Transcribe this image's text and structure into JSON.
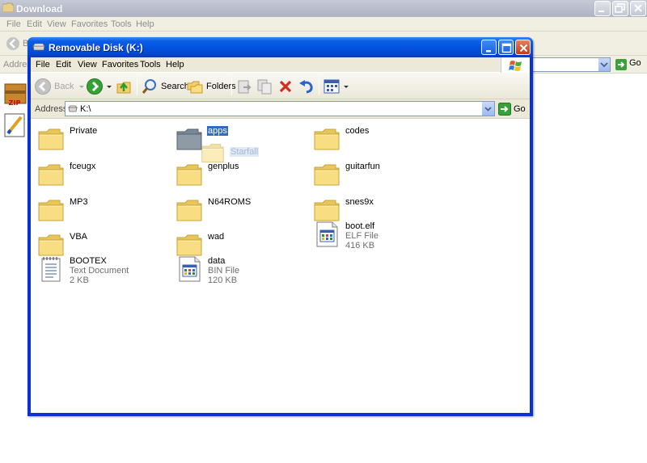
{
  "background_window": {
    "title": "Download",
    "menu": [
      "File",
      "Edit",
      "View",
      "Favorites",
      "Tools",
      "Help"
    ],
    "address_label": "Address",
    "back_label": "B",
    "go_label": "Go"
  },
  "window": {
    "title": "Removable Disk (K:)",
    "menu": [
      "File",
      "Edit",
      "View",
      "Favorites",
      "Tools",
      "Help"
    ],
    "toolbar": {
      "back": "Back",
      "search": "Search",
      "folders": "Folders"
    },
    "address": {
      "label": "Address",
      "value": "K:\\",
      "go": "Go"
    }
  },
  "files": [
    {
      "name": "Private",
      "type": "folder"
    },
    {
      "name": "apps",
      "type": "folder",
      "selected": true
    },
    {
      "name": "codes",
      "type": "folder"
    },
    {
      "name": "fceugx",
      "type": "folder"
    },
    {
      "name": "genplus",
      "type": "folder"
    },
    {
      "name": "guitarfun",
      "type": "folder"
    },
    {
      "name": "MP3",
      "type": "folder"
    },
    {
      "name": "N64ROMS",
      "type": "folder"
    },
    {
      "name": "snes9x",
      "type": "folder"
    },
    {
      "name": "VBA",
      "type": "folder"
    },
    {
      "name": "wad",
      "type": "folder"
    },
    {
      "name": "boot.elf",
      "type": "file",
      "kind": "ELF File",
      "size": "416 KB"
    },
    {
      "name": "BOOTEX",
      "type": "text",
      "kind": "Text Document",
      "size": "2 KB"
    },
    {
      "name": "data",
      "type": "file",
      "kind": "BIN File",
      "size": "120 KB"
    }
  ],
  "drag_ghost": {
    "name": "Starfall"
  },
  "colors": {
    "titlebar": "#0453e0",
    "selection": "#316ac5",
    "chrome": "#ece9d8",
    "folder": "#f6d774"
  }
}
